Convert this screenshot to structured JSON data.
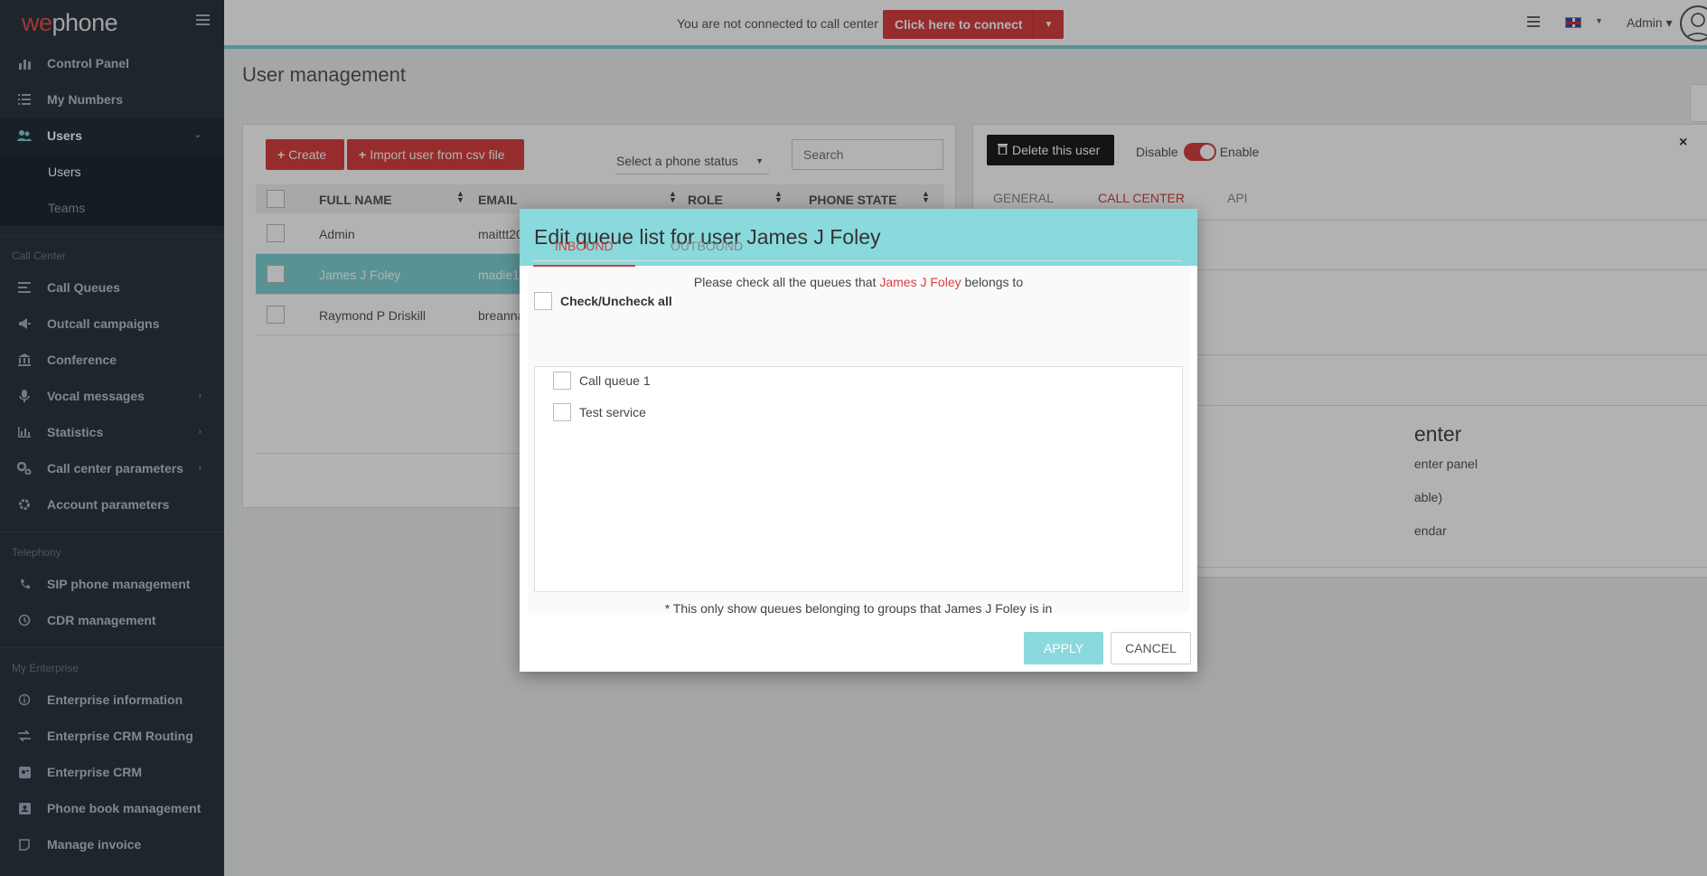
{
  "brand": {
    "logo_we": "we",
    "logo_rest": "phone"
  },
  "sidebar": {
    "items_top": [
      {
        "label": "Control Panel",
        "icon": "bar-chart-icon"
      },
      {
        "label": "My Numbers",
        "icon": "list-icon"
      },
      {
        "label": "Users",
        "icon": "users-icon"
      }
    ],
    "users_sub": [
      "Users",
      "Teams"
    ],
    "section_call_center": "Call Center",
    "items_call_center": [
      {
        "label": "Call Queues",
        "icon": "queue-icon"
      },
      {
        "label": "Outcall campaigns",
        "icon": "megaphone-icon"
      },
      {
        "label": "Conference",
        "icon": "bank-icon"
      },
      {
        "label": "Vocal messages",
        "icon": "microphone-icon"
      },
      {
        "label": "Statistics",
        "icon": "stats-icon"
      },
      {
        "label": "Call center parameters",
        "icon": "cogs-icon"
      },
      {
        "label": "Account parameters",
        "icon": "gear-icon"
      }
    ],
    "section_telephony": "Telephony",
    "items_telephony": [
      {
        "label": "SIP phone management",
        "icon": "phone-icon"
      },
      {
        "label": "CDR management",
        "icon": "history-icon"
      }
    ],
    "section_enterprise": "My Enterprise",
    "items_enterprise": [
      {
        "label": "Enterprise information",
        "icon": "info-icon"
      },
      {
        "label": "Enterprise CRM Routing",
        "icon": "exchange-icon"
      },
      {
        "label": "Enterprise CRM",
        "icon": "crm-icon"
      },
      {
        "label": "Phone book management",
        "icon": "book-icon"
      },
      {
        "label": "Manage invoice",
        "icon": "invoice-icon"
      }
    ]
  },
  "topbar": {
    "notice": "You are not connected to call center",
    "connect_label": "Click here to connect",
    "admin_label": "Admin"
  },
  "page": {
    "title": "User management"
  },
  "users_panel": {
    "create_label": "Create",
    "import_label": "Import user from csv file",
    "phone_status_placeholder": "Select a phone status",
    "search_placeholder": "Search",
    "columns": [
      "FULL NAME",
      "EMAIL",
      "ROLE",
      "PHONE STATE"
    ],
    "rows": [
      {
        "name": "Admin",
        "email": "maittt20"
      },
      {
        "name": "James J Foley",
        "email": "madie1"
      },
      {
        "name": "Raymond P Driskill",
        "email": "breanna"
      }
    ]
  },
  "user_detail": {
    "delete_label": "Delete this user",
    "disable_label": "Disable",
    "enable_label": "Enable",
    "tabs": [
      "GENERAL",
      "CALL CENTER",
      "API"
    ],
    "heading_fragment": "enter",
    "line1": "enter panel",
    "line2": "able)",
    "line3": "endar"
  },
  "modal": {
    "title": "Edit queue list for user James J Foley",
    "tabs": [
      "INBOUND",
      "OUTBOUND"
    ],
    "instruction_pre": "Please check all the queues that",
    "instruction_name": "James J Foley",
    "instruction_post": "belongs to",
    "check_all_label": "Check/Uncheck all",
    "queues": [
      "Call queue 1",
      "Test service"
    ],
    "footnote": "* This only show queues belonging to groups that James J Foley is in",
    "apply_label": "APPLY",
    "cancel_label": "CANCEL"
  },
  "colors": {
    "accent": "#d83f3f",
    "teal": "#8ad9dd",
    "sidebar": "#2b3640"
  }
}
